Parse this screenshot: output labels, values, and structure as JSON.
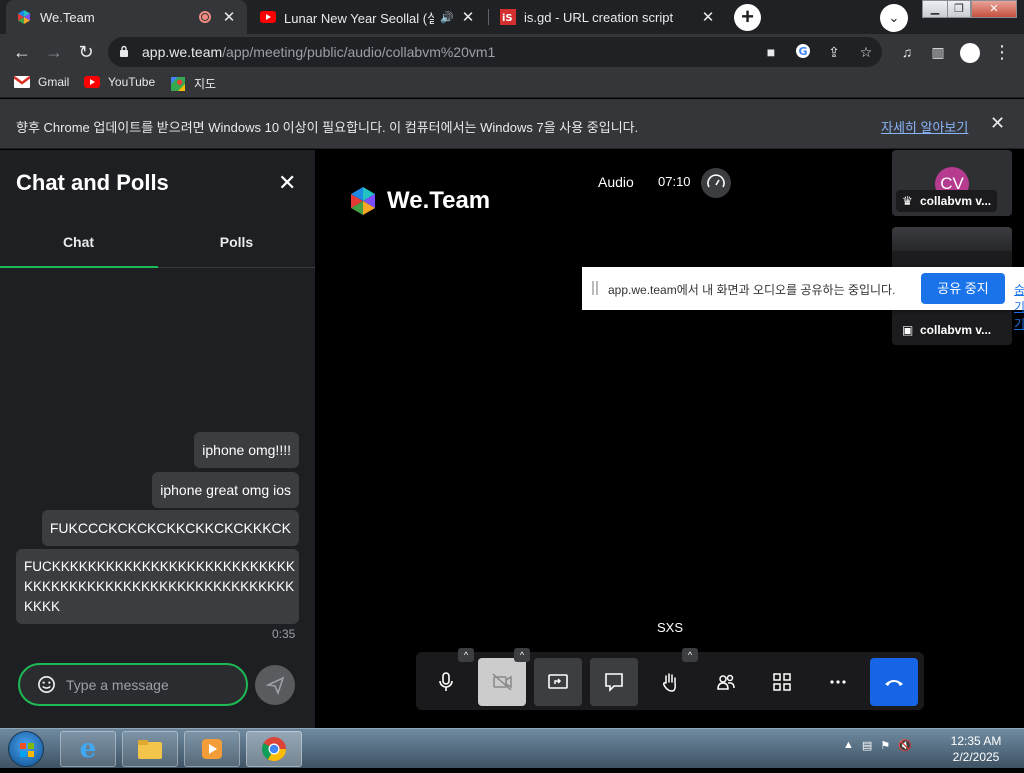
{
  "browser": {
    "tabs": [
      {
        "title": "We.Team",
        "active": true
      },
      {
        "title": "Lunar New Year Seollal (설날",
        "active": false
      },
      {
        "title": "is.gd - URL creation script",
        "active": false
      }
    ],
    "url_host": "app.we.team",
    "url_path": "/app/meeting/public/audio/collabvm%20vm1",
    "bookmarks": [
      "Gmail",
      "YouTube",
      "지도"
    ],
    "infobar_message": "향후 Chrome 업데이트를 받으려면 Windows 10 이상이 필요합니다. 이 컴퓨터에서는 Windows 7을 사용 중입니다.",
    "infobar_link": "자세히 알아보기"
  },
  "chat": {
    "title": "Chat and Polls",
    "tabs": [
      "Chat",
      "Polls"
    ],
    "messages": [
      "iphone omg!!!!",
      "iphone great omg ios",
      "FUKCCCKCKCKCKKCKKCKCKKKCK",
      "FUCKKKKKKKKKKKKKKKKKKKKKKKKKKK",
      "KKKKKKKKKKKKKKKKKKKKKKKKKKKKKK",
      "KKKK"
    ],
    "last_time": "0:35",
    "placeholder": "Type a message"
  },
  "meeting": {
    "brand": "We.Team",
    "mode": "Audio",
    "elapsed": "07:10",
    "participants": [
      {
        "initials": "CV",
        "name": "collabvm v..."
      },
      {
        "name": "collabvm v..."
      }
    ],
    "share_notice": "app.we.team에서 내 화면과 오디오를 공유하는 중입니다.",
    "share_stop": "공유 중지",
    "share_hide": "숨기기",
    "speaker": "SXS"
  },
  "taskbar": {
    "time": "12:35 AM",
    "date": "2/2/2025"
  },
  "colors": {
    "accent_green": "#1db954",
    "end_call_blue": "#1565e6",
    "chrome_dark": "#35363a"
  }
}
